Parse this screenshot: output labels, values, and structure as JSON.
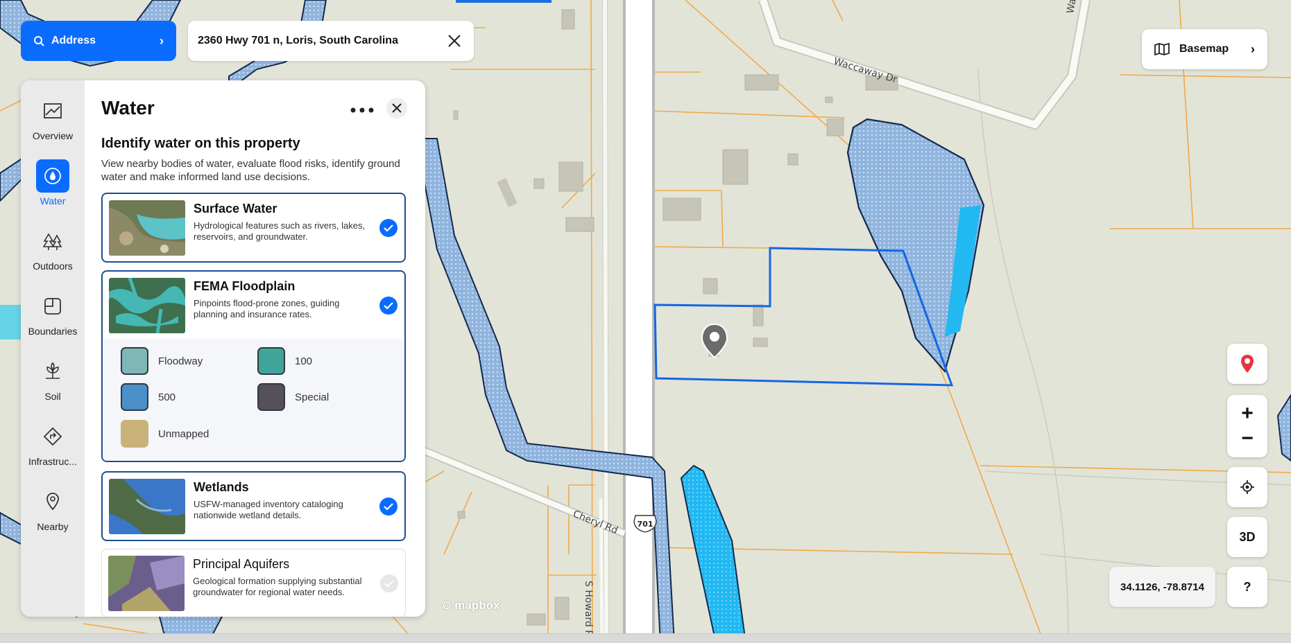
{
  "search": {
    "mode_label": "Address",
    "address_value": "2360 Hwy 701 n, Loris, South Carolina"
  },
  "basemap": {
    "label": "Basemap"
  },
  "sidebar": {
    "items": [
      {
        "label": "Overview",
        "icon": "map-icon"
      },
      {
        "label": "Water",
        "icon": "water-drop-icon",
        "active": true
      },
      {
        "label": "Outdoors",
        "icon": "trees-icon"
      },
      {
        "label": "Boundaries",
        "icon": "boundaries-icon"
      },
      {
        "label": "Soil",
        "icon": "plant-icon"
      },
      {
        "label": "Infrastruc...",
        "icon": "road-sign-icon"
      },
      {
        "label": "Nearby",
        "icon": "location-pin-icon"
      }
    ]
  },
  "panel": {
    "title": "Water",
    "section_title": "Identify water on this property",
    "section_desc": "View nearby bodies of water, evaluate flood risks, identify ground water and make informed land use decisions.",
    "layers": [
      {
        "name": "Surface Water",
        "desc": "Hydrological features such as rivers, lakes, reservoirs, and groundwater.",
        "checked": true
      },
      {
        "name": "FEMA Floodplain",
        "desc": "Pinpoints flood-prone zones, guiding planning and insurance rates.",
        "checked": true
      },
      {
        "name": "Wetlands",
        "desc": "USFW-managed inventory cataloging nationwide wetland details.",
        "checked": true
      },
      {
        "name": "Principal Aquifers",
        "desc": "Geological formation supplying substantial groundwater for regional water needs.",
        "checked": false
      }
    ],
    "legend": [
      {
        "label": "Floodway",
        "color": "#7fb7b7"
      },
      {
        "label": "100",
        "color": "#3fa59b"
      },
      {
        "label": "500",
        "color": "#4b8fc9"
      },
      {
        "label": "Special",
        "color": "#55505a"
      },
      {
        "label": "Unmapped",
        "color": "#c9b27a"
      }
    ]
  },
  "map": {
    "roads": {
      "waccaway": "Waccaway Dr",
      "waccaway_top": "Waccaw",
      "cheryl": "Cheryl Rd",
      "howard": "S Howard R",
      "highway_shield": "701"
    },
    "attribution": "mapbox",
    "coordinates": "34.1126, -78.8714"
  },
  "controls": {
    "view_3d": "3D",
    "help": "?",
    "zoom_in": "+",
    "zoom_out": "−"
  },
  "colors": {
    "accent": "#0a6cff",
    "parcel_line": "#f0a94a",
    "boundary": "#1466e0",
    "water_fill": "#8fb4de",
    "water_bright": "#22b8f2"
  }
}
